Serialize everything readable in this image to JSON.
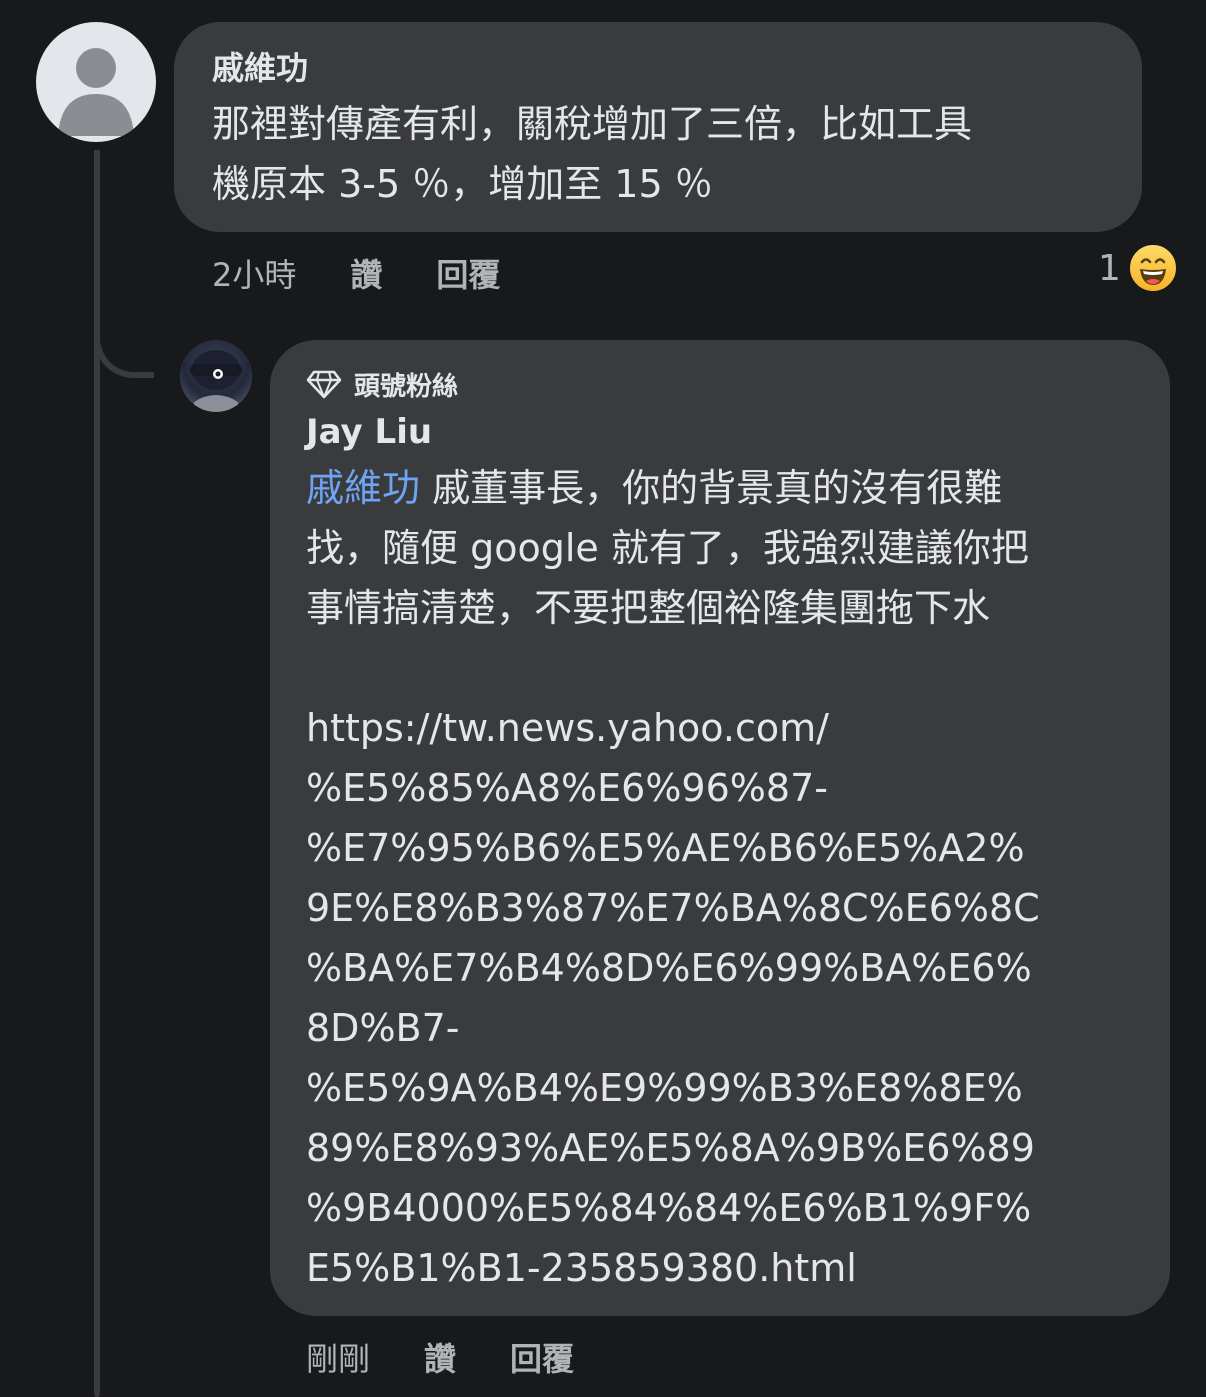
{
  "comment": {
    "author": "戚維功",
    "text_lines": [
      "那裡對傳產有利，關稅增加了三倍，比如工具",
      "機原本 3-5 ％，增加至 15 ％"
    ],
    "time": "2小時",
    "like_label": "讚",
    "reply_label": "回覆",
    "reaction": {
      "count": "1",
      "emoji": "😄",
      "icon": "haha-reaction-icon"
    }
  },
  "reply": {
    "badge_icon": "diamond-icon",
    "badge_label": "頭號粉絲",
    "author": "Jay Liu",
    "mention": "戚維功",
    "text_line1_rest": " 戚董事長，你的背景真的沒有很難",
    "text_line2": "找，隨便 google 就有了，我強烈建議你把",
    "text_line3": "事情搞清楚，不要把整個裕隆集團拖下水",
    "url_lines": [
      "https://tw.news.yahoo.com/",
      "%E5%85%A8%E6%96%87-",
      "%E7%95%B6%E5%AE%B6%E5%A2%",
      "9E%E8%B3%87%E7%BA%8C%E6%8C",
      "%BA%E7%B4%8D%E6%99%BA%E6%",
      "8D%B7-",
      "%E5%9A%B4%E9%99%B3%E8%8E%",
      "89%E8%93%AE%E5%8A%9B%E6%89",
      "%9B4000%E5%84%84%E6%B1%9F%",
      "E5%B1%B1-235859380.html"
    ],
    "time": "剛剛",
    "like_label": "讚",
    "reply_label": "回覆"
  }
}
